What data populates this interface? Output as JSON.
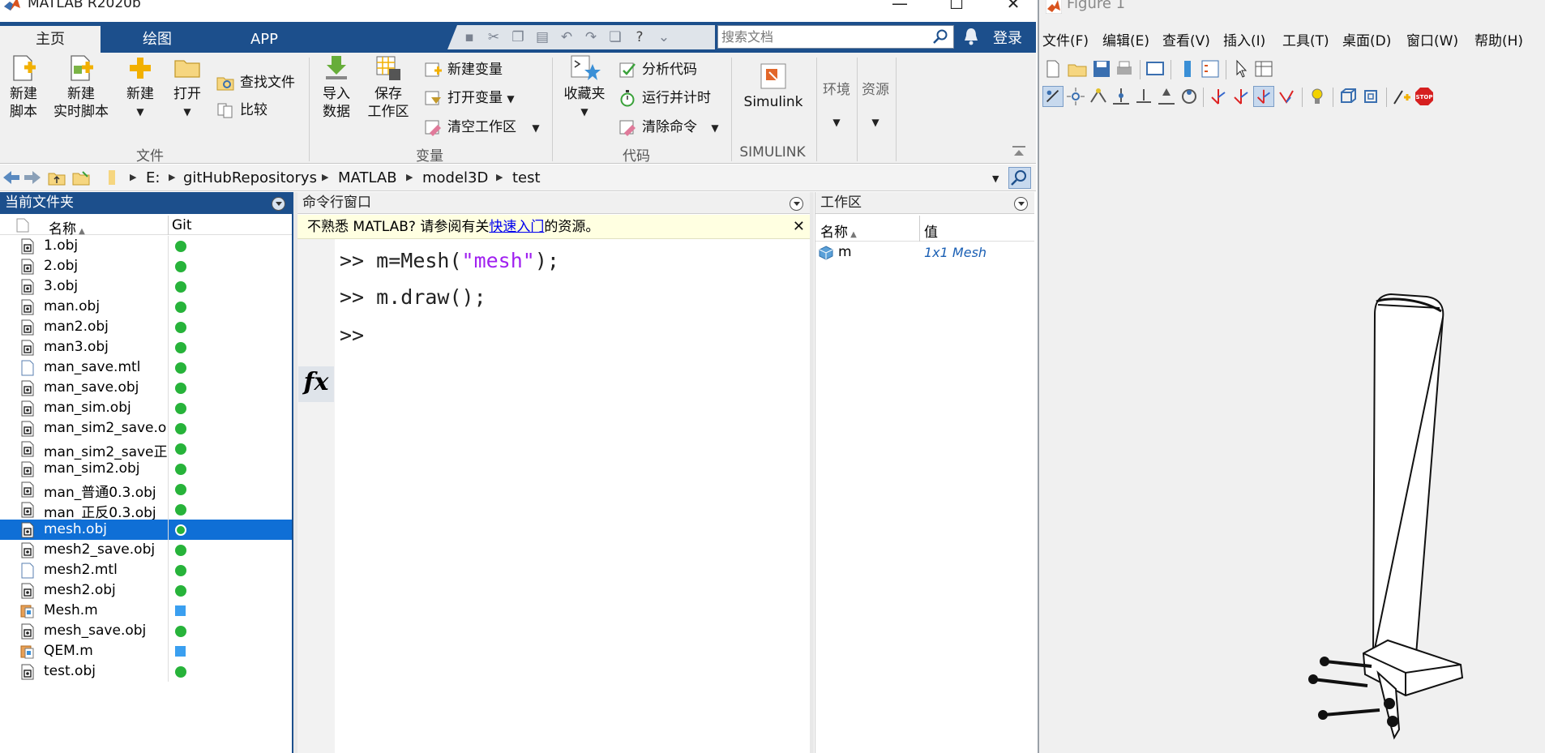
{
  "matlab": {
    "title": "MATLAB R2020b",
    "tabs": [
      "主页",
      "绘图",
      "APP"
    ],
    "search_placeholder": "搜索文档",
    "login": "登录",
    "ribbon": {
      "file": {
        "new_script": [
          "新建",
          "脚本"
        ],
        "new_live_script": [
          "新建",
          "实时脚本"
        ],
        "new": "新建",
        "open": "打开",
        "find_files": "查找文件",
        "compare": "比较",
        "label": "文件"
      },
      "variable": {
        "import_data": [
          "导入",
          "数据"
        ],
        "save_workspace": [
          "保存",
          "工作区"
        ],
        "new_variable": "新建变量",
        "open_variable": "打开变量",
        "clear_workspace": "清空工作区",
        "label": "变量"
      },
      "code": {
        "favorites": "收藏夹",
        "analyze_code": "分析代码",
        "run_and_time": "运行并计时",
        "clear_commands": "清除命令",
        "label": "代码"
      },
      "simulink": {
        "button": "Simulink",
        "label": "SIMULINK"
      },
      "environment": "环境",
      "resources": "资源"
    },
    "address": {
      "crumbs": [
        "E:",
        "gitHubRepositorys",
        "MATLAB",
        "model3D",
        "test"
      ]
    },
    "current_folder": {
      "title": "当前文件夹",
      "col_name": "名称",
      "col_git": "Git",
      "files": [
        {
          "name": "1.obj",
          "type": "obj",
          "git": "green"
        },
        {
          "name": "2.obj",
          "type": "obj",
          "git": "green"
        },
        {
          "name": "3.obj",
          "type": "obj",
          "git": "green"
        },
        {
          "name": "man.obj",
          "type": "obj",
          "git": "green"
        },
        {
          "name": "man2.obj",
          "type": "obj",
          "git": "green"
        },
        {
          "name": "man3.obj",
          "type": "obj",
          "git": "green"
        },
        {
          "name": "man_save.mtl",
          "type": "mtl",
          "git": "green"
        },
        {
          "name": "man_save.obj",
          "type": "obj",
          "git": "green"
        },
        {
          "name": "man_sim.obj",
          "type": "obj",
          "git": "green"
        },
        {
          "name": "man_sim2_save.o..",
          "type": "obj",
          "git": "green"
        },
        {
          "name": "man_sim2_save正..",
          "type": "obj",
          "git": "green"
        },
        {
          "name": "man_sim2.obj",
          "type": "obj",
          "git": "green"
        },
        {
          "name": "man_普通0.3.obj",
          "type": "obj",
          "git": "green"
        },
        {
          "name": "man_正反0.3.obj",
          "type": "obj",
          "git": "green"
        },
        {
          "name": "mesh.obj",
          "type": "obj",
          "git": "green",
          "selected": true
        },
        {
          "name": "mesh2_save.obj",
          "type": "obj",
          "git": "green"
        },
        {
          "name": "mesh2.mtl",
          "type": "mtl",
          "git": "green"
        },
        {
          "name": "mesh2.obj",
          "type": "obj",
          "git": "green"
        },
        {
          "name": "Mesh.m",
          "type": "m",
          "git": "blue"
        },
        {
          "name": "mesh_save.obj",
          "type": "obj",
          "git": "green"
        },
        {
          "name": "QEM.m",
          "type": "m",
          "git": "blue"
        },
        {
          "name": "test.obj",
          "type": "obj",
          "git": "green"
        }
      ]
    },
    "command_window": {
      "title": "命令行窗口",
      "notice_prefix": "不熟悉 MATLAB? 请参阅有关",
      "notice_link": "快速入门",
      "notice_suffix": "的资源。",
      "notice_close": "✕",
      "fx": "fx",
      "prompt": ">>",
      "lines": [
        {
          "pre": "m=Mesh(",
          "str": "\"mesh\"",
          "post": ");"
        },
        {
          "pre": "m.draw();",
          "str": "",
          "post": ""
        }
      ]
    },
    "workspace": {
      "title": "工作区",
      "col_name": "名称",
      "col_value": "值",
      "vars": [
        {
          "name": "m",
          "value": "1x1 Mesh"
        }
      ]
    }
  },
  "figure": {
    "title": "Figure 1",
    "menu": [
      "文件(F)",
      "编辑(E)",
      "查看(V)",
      "插入(I)",
      "工具(T)",
      "桌面(D)",
      "窗口(W)",
      "帮助(H)"
    ]
  },
  "colors": {
    "accent_blue": "#1c4f8c",
    "selection": "#0f6fd6",
    "git_green": "#27b33a",
    "git_blue": "#3a9ff0",
    "string_purple": "#a020f0"
  }
}
